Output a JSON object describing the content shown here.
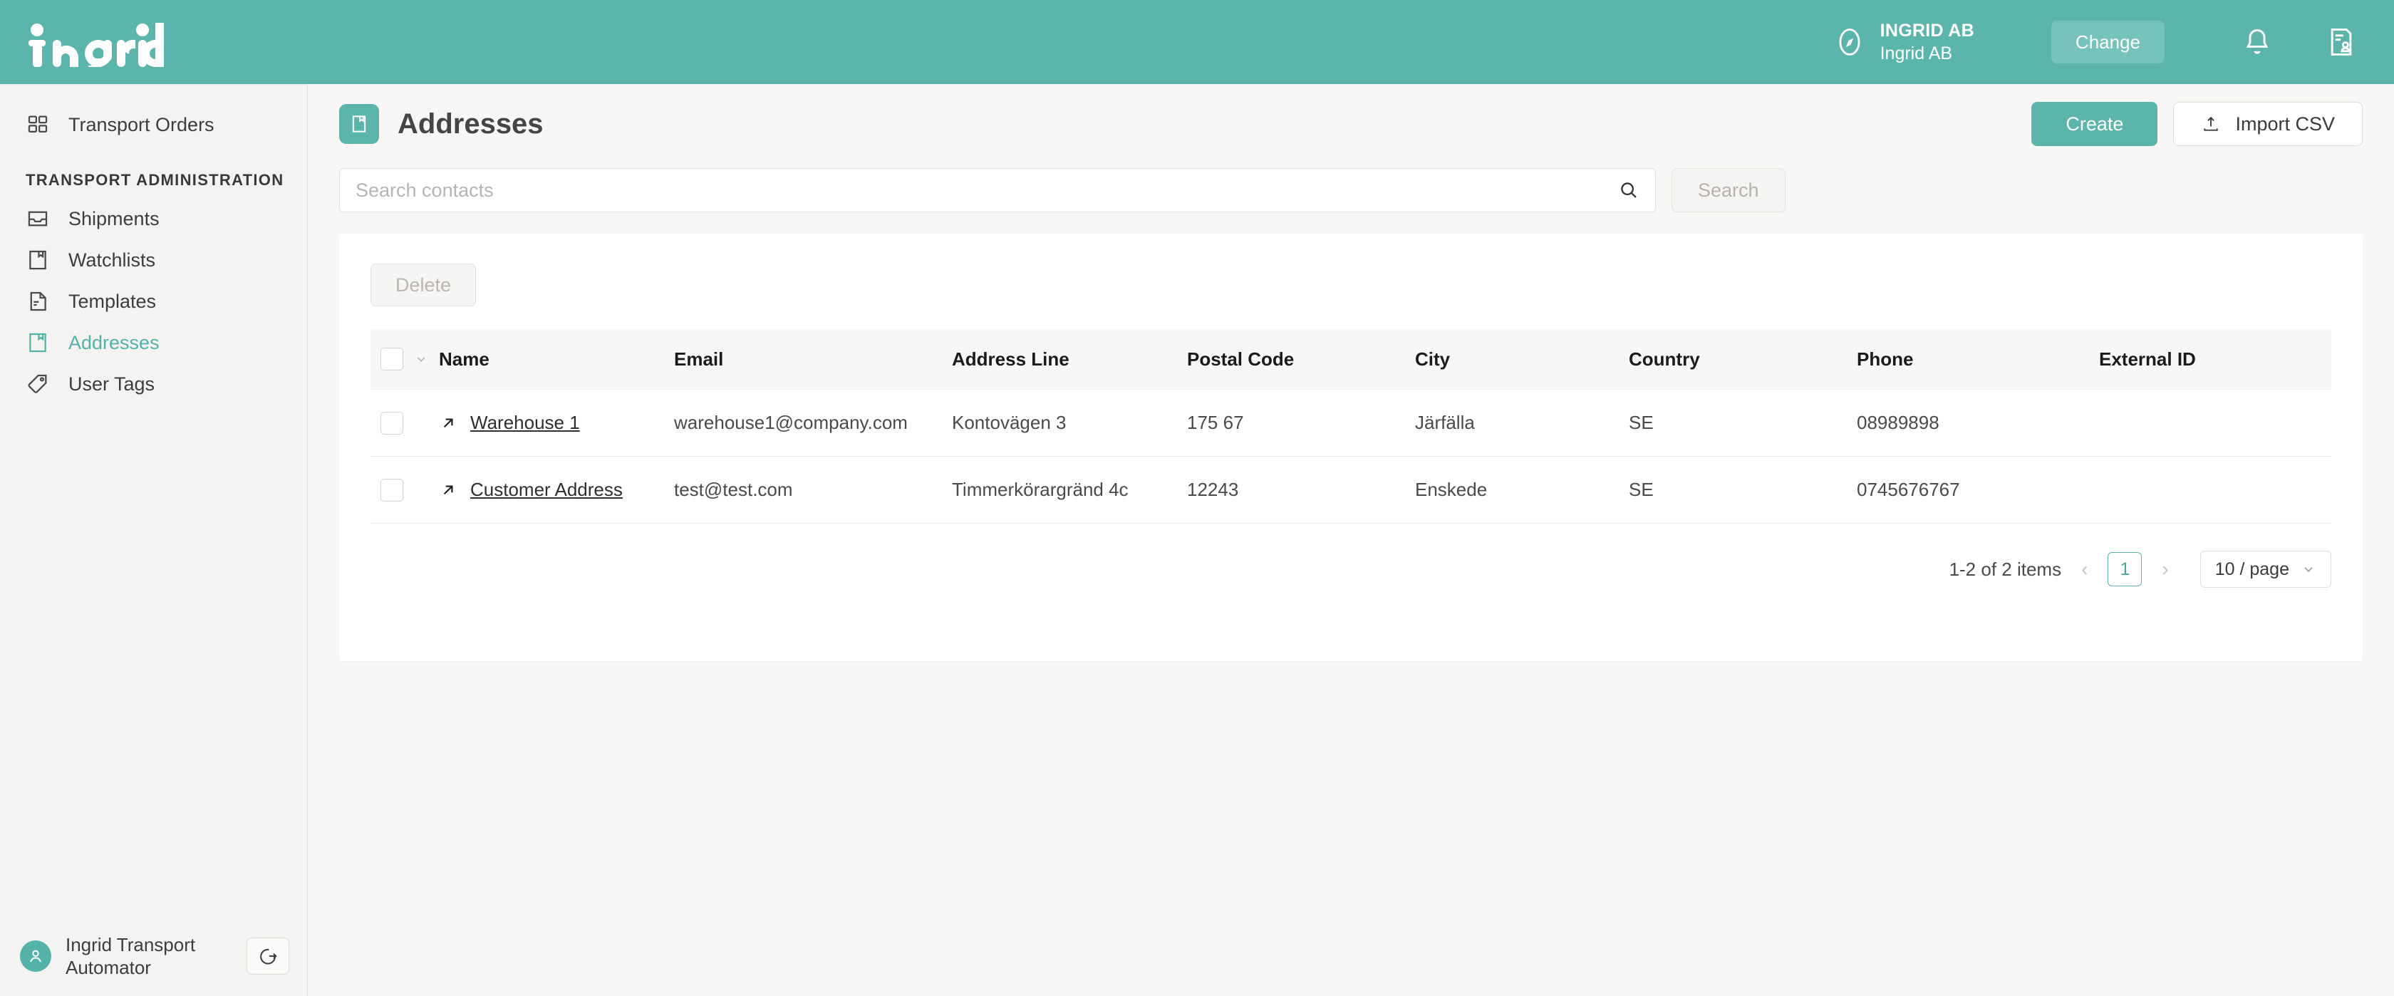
{
  "brand": {
    "logo_text": "ingrid",
    "accent": "#5bb5ab",
    "accent_dark": "#4aa79d"
  },
  "header": {
    "org_name": "INGRID AB",
    "org_sub": "Ingrid AB",
    "change_label": "Change",
    "compass_icon": "compass-icon",
    "bell_icon": "bell-icon",
    "contact-card_icon": "contact-card-icon"
  },
  "sidebar": {
    "top_items": [
      {
        "label": "Transport Orders",
        "icon": "grid-icon",
        "active": false
      }
    ],
    "section_label": "TRANSPORT ADMINISTRATION",
    "items": [
      {
        "label": "Shipments",
        "icon": "inbox-icon",
        "active": false
      },
      {
        "label": "Watchlists",
        "icon": "bookmark-doc-icon",
        "active": false
      },
      {
        "label": "Templates",
        "icon": "document-icon",
        "active": false
      },
      {
        "label": "Addresses",
        "icon": "bookmark-doc-icon",
        "active": true
      },
      {
        "label": "User Tags",
        "icon": "tag-icon",
        "active": false
      }
    ],
    "user": {
      "name": "Ingrid Transport Automator",
      "avatar_icon": "user-avatar-icon",
      "logout_icon": "logout-icon"
    }
  },
  "page": {
    "title": "Addresses",
    "title_icon": "address-book-icon",
    "create_label": "Create",
    "import_label": "Import CSV",
    "import_icon": "upload-icon"
  },
  "search": {
    "placeholder": "Search contacts",
    "value": "",
    "icon": "search-icon",
    "button_label": "Search"
  },
  "toolbar": {
    "delete_label": "Delete"
  },
  "table": {
    "columns": [
      "Name",
      "Email",
      "Address Line",
      "Postal Code",
      "City",
      "Country",
      "Phone",
      "External ID"
    ],
    "select_all_checked": false,
    "rows": [
      {
        "checked": false,
        "link_icon": "external-link-arrow-icon",
        "name": "Warehouse 1",
        "email": "warehouse1@company.com",
        "address_line": "Kontovägen 3",
        "postal_code": "175 67",
        "city": "Järfälla",
        "country": "SE",
        "phone": "08989898",
        "external_id": ""
      },
      {
        "checked": false,
        "link_icon": "external-link-arrow-icon",
        "name": "Customer Address",
        "email": "test@test.com",
        "address_line": "Timmerkörargränd 4c",
        "postal_code": "12243",
        "city": "Enskede",
        "country": "SE",
        "phone": "0745676767",
        "external_id": ""
      }
    ]
  },
  "pagination": {
    "summary": "1-2 of 2 items",
    "prev": "‹",
    "next": "›",
    "current_page": "1",
    "page_size": "10 / page"
  }
}
